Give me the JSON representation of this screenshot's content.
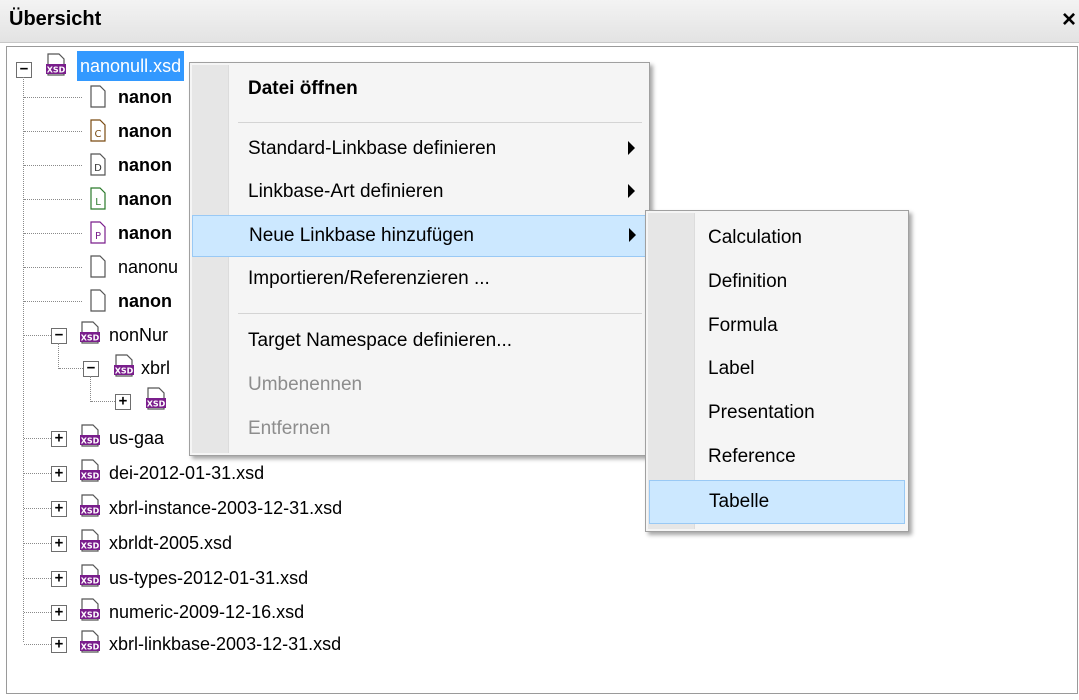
{
  "panel": {
    "title": "Übersicht",
    "close_label": "×"
  },
  "tree": {
    "root": "nanonull.xsd",
    "children": [
      "nanon",
      "nanon",
      "nanon",
      "nanon",
      "nanon",
      "nanonu",
      "nanon",
      "nonNur",
      "xbrl",
      "",
      "us-gaa",
      "dei-2012-01-31.xsd",
      "xbrl-instance-2003-12-31.xsd",
      "xbrldt-2005.xsd",
      "us-types-2012-01-31.xsd",
      "numeric-2009-12-16.xsd",
      "xbrl-linkbase-2003-12-31.xsd"
    ],
    "file_badges": [
      "",
      "C",
      "D",
      "L",
      "P",
      "",
      ""
    ],
    "xsd_badge": "XSD",
    "toggle_minus": "−",
    "toggle_plus": "+"
  },
  "context_menu": {
    "items": [
      {
        "label": "Datei öffnen",
        "bold": true
      },
      {
        "label": "Standard-Linkbase definieren",
        "submenu": true
      },
      {
        "label": "Linkbase-Art definieren",
        "submenu": true
      },
      {
        "label": "Neue Linkbase hinzufügen",
        "submenu": true,
        "highlighted": true
      },
      {
        "label": "Importieren/Referenzieren ..."
      },
      {
        "label": "Target Namespace definieren..."
      },
      {
        "label": "Umbenennen",
        "disabled": true
      },
      {
        "label": "Entfernen",
        "disabled": true
      }
    ]
  },
  "submenu": {
    "items": [
      "Calculation",
      "Definition",
      "Formula",
      "Label",
      "Presentation",
      "Reference",
      "Tabelle"
    ],
    "highlighted": "Tabelle"
  },
  "colors": {
    "selection": "#3399ff",
    "menu_highlight": "#cce8ff",
    "xsd_icon": "#7a1e8c"
  }
}
